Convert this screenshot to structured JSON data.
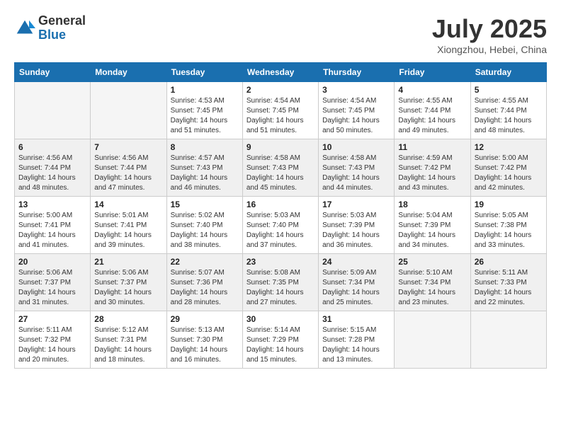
{
  "logo": {
    "general": "General",
    "blue": "Blue"
  },
  "title": "July 2025",
  "location": "Xiongzhou, Hebei, China",
  "days_of_week": [
    "Sunday",
    "Monday",
    "Tuesday",
    "Wednesday",
    "Thursday",
    "Friday",
    "Saturday"
  ],
  "weeks": [
    [
      {
        "day": null
      },
      {
        "day": null
      },
      {
        "day": "1",
        "sunrise": "4:53 AM",
        "sunset": "7:45 PM",
        "daylight": "14 hours and 51 minutes."
      },
      {
        "day": "2",
        "sunrise": "4:54 AM",
        "sunset": "7:45 PM",
        "daylight": "14 hours and 51 minutes."
      },
      {
        "day": "3",
        "sunrise": "4:54 AM",
        "sunset": "7:45 PM",
        "daylight": "14 hours and 50 minutes."
      },
      {
        "day": "4",
        "sunrise": "4:55 AM",
        "sunset": "7:44 PM",
        "daylight": "14 hours and 49 minutes."
      },
      {
        "day": "5",
        "sunrise": "4:55 AM",
        "sunset": "7:44 PM",
        "daylight": "14 hours and 48 minutes."
      }
    ],
    [
      {
        "day": "6",
        "sunrise": "4:56 AM",
        "sunset": "7:44 PM",
        "daylight": "14 hours and 48 minutes."
      },
      {
        "day": "7",
        "sunrise": "4:56 AM",
        "sunset": "7:44 PM",
        "daylight": "14 hours and 47 minutes."
      },
      {
        "day": "8",
        "sunrise": "4:57 AM",
        "sunset": "7:43 PM",
        "daylight": "14 hours and 46 minutes."
      },
      {
        "day": "9",
        "sunrise": "4:58 AM",
        "sunset": "7:43 PM",
        "daylight": "14 hours and 45 minutes."
      },
      {
        "day": "10",
        "sunrise": "4:58 AM",
        "sunset": "7:43 PM",
        "daylight": "14 hours and 44 minutes."
      },
      {
        "day": "11",
        "sunrise": "4:59 AM",
        "sunset": "7:42 PM",
        "daylight": "14 hours and 43 minutes."
      },
      {
        "day": "12",
        "sunrise": "5:00 AM",
        "sunset": "7:42 PM",
        "daylight": "14 hours and 42 minutes."
      }
    ],
    [
      {
        "day": "13",
        "sunrise": "5:00 AM",
        "sunset": "7:41 PM",
        "daylight": "14 hours and 41 minutes."
      },
      {
        "day": "14",
        "sunrise": "5:01 AM",
        "sunset": "7:41 PM",
        "daylight": "14 hours and 39 minutes."
      },
      {
        "day": "15",
        "sunrise": "5:02 AM",
        "sunset": "7:40 PM",
        "daylight": "14 hours and 38 minutes."
      },
      {
        "day": "16",
        "sunrise": "5:03 AM",
        "sunset": "7:40 PM",
        "daylight": "14 hours and 37 minutes."
      },
      {
        "day": "17",
        "sunrise": "5:03 AM",
        "sunset": "7:39 PM",
        "daylight": "14 hours and 36 minutes."
      },
      {
        "day": "18",
        "sunrise": "5:04 AM",
        "sunset": "7:39 PM",
        "daylight": "14 hours and 34 minutes."
      },
      {
        "day": "19",
        "sunrise": "5:05 AM",
        "sunset": "7:38 PM",
        "daylight": "14 hours and 33 minutes."
      }
    ],
    [
      {
        "day": "20",
        "sunrise": "5:06 AM",
        "sunset": "7:37 PM",
        "daylight": "14 hours and 31 minutes."
      },
      {
        "day": "21",
        "sunrise": "5:06 AM",
        "sunset": "7:37 PM",
        "daylight": "14 hours and 30 minutes."
      },
      {
        "day": "22",
        "sunrise": "5:07 AM",
        "sunset": "7:36 PM",
        "daylight": "14 hours and 28 minutes."
      },
      {
        "day": "23",
        "sunrise": "5:08 AM",
        "sunset": "7:35 PM",
        "daylight": "14 hours and 27 minutes."
      },
      {
        "day": "24",
        "sunrise": "5:09 AM",
        "sunset": "7:34 PM",
        "daylight": "14 hours and 25 minutes."
      },
      {
        "day": "25",
        "sunrise": "5:10 AM",
        "sunset": "7:34 PM",
        "daylight": "14 hours and 23 minutes."
      },
      {
        "day": "26",
        "sunrise": "5:11 AM",
        "sunset": "7:33 PM",
        "daylight": "14 hours and 22 minutes."
      }
    ],
    [
      {
        "day": "27",
        "sunrise": "5:11 AM",
        "sunset": "7:32 PM",
        "daylight": "14 hours and 20 minutes."
      },
      {
        "day": "28",
        "sunrise": "5:12 AM",
        "sunset": "7:31 PM",
        "daylight": "14 hours and 18 minutes."
      },
      {
        "day": "29",
        "sunrise": "5:13 AM",
        "sunset": "7:30 PM",
        "daylight": "14 hours and 16 minutes."
      },
      {
        "day": "30",
        "sunrise": "5:14 AM",
        "sunset": "7:29 PM",
        "daylight": "14 hours and 15 minutes."
      },
      {
        "day": "31",
        "sunrise": "5:15 AM",
        "sunset": "7:28 PM",
        "daylight": "14 hours and 13 minutes."
      },
      {
        "day": null
      },
      {
        "day": null
      }
    ]
  ]
}
